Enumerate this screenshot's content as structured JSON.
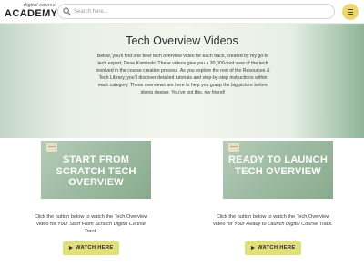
{
  "header": {
    "logo_small": "digital course",
    "logo_big": "ACADEMY",
    "search_placeholder": "Search here...",
    "menu_icon": "hamburger-icon",
    "accent_color": "#ecd86a"
  },
  "hero": {
    "title": "Tech Overview Videos",
    "body": "Below, you'll find one brief tech overview video for each track, created by my go-to tech expert, Dave Kaminski. These videos give you a 30,000-foot view of the tech involved in the course creation process. As you explore the rest of the Resources & Tech Library, you'll discover detailed tutorials and step-by-step instructions within each category. These overviews are here to help you grasp the big picture before diving deeper. You've got this, my friend!"
  },
  "cards": [
    {
      "thumb_title": "START FROM SCRATCH TECH OVERVIEW",
      "desc_prefix": "Click the button below to watch the Tech Overview video for ",
      "desc_italic": "Your Start From Scratch Digital Course Track.",
      "button_label": "WATCH HERE"
    },
    {
      "thumb_title": "READY TO LAUNCH TECH OVERVIEW",
      "desc_prefix": "Click the button below to watch the Tech Overview video for ",
      "desc_italic": "Your Ready to Launch Digital Course Track.",
      "button_label": "WATCH HERE"
    }
  ],
  "colors": {
    "button": "#dfe07a",
    "thumb": "#9fbca3"
  }
}
